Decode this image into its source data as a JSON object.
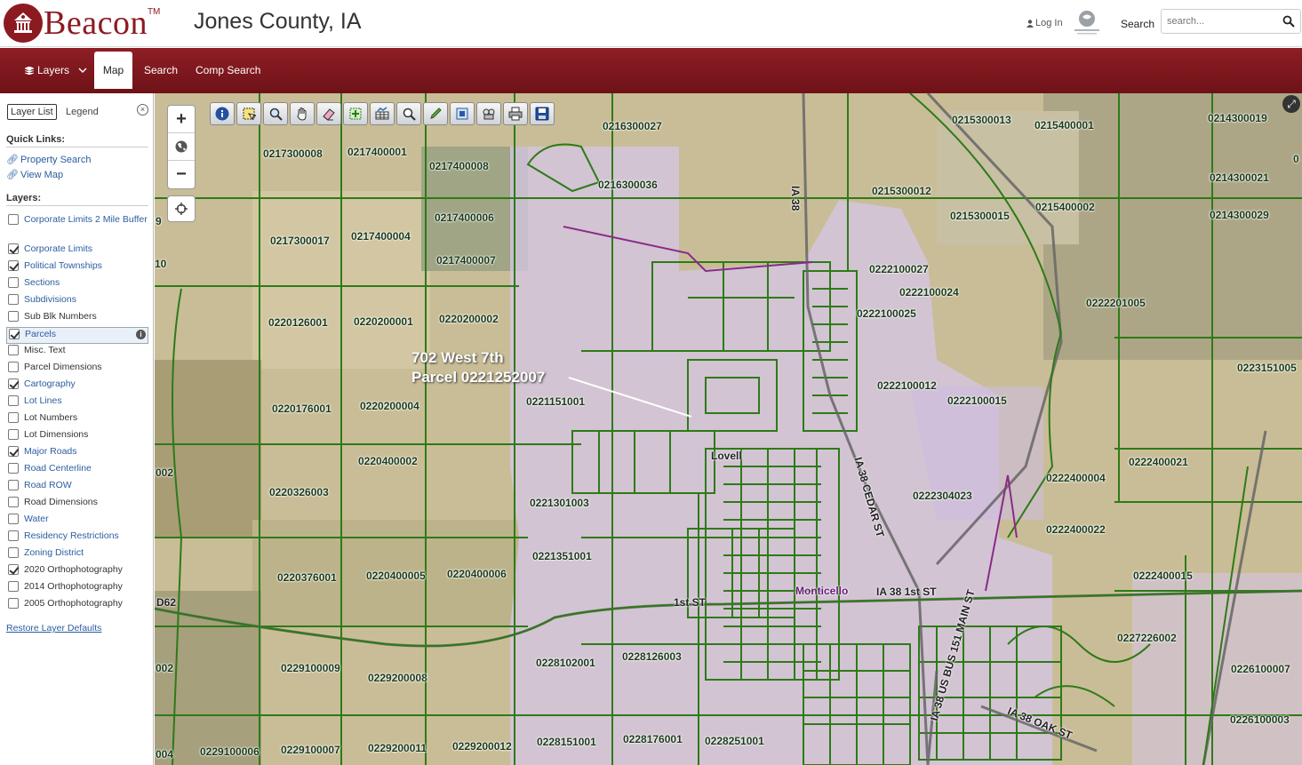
{
  "header": {
    "brand": "Beacon",
    "trademark": "TM",
    "county_title": "Jones County, IA",
    "login_label": "Log In",
    "search_label": "Search",
    "search_placeholder": "search..."
  },
  "nav": {
    "layers": "Layers",
    "map": "Map",
    "search": "Search",
    "comp_search": "Comp Search"
  },
  "panel": {
    "tab_layer_list": "Layer List",
    "tab_legend": "Legend",
    "quick_links_title": "Quick Links:",
    "quick_links": [
      "Property Search",
      "View Map"
    ],
    "layers_title": "Layers:",
    "layers": [
      {
        "label": "Corporate Limits 2 Mile Buffer",
        "checked": false
      },
      {
        "label": "Corporate Limits",
        "checked": true
      },
      {
        "label": "Political Townships",
        "checked": true
      },
      {
        "label": "Sections",
        "checked": false
      },
      {
        "label": "Subdivisions",
        "checked": false
      },
      {
        "label": "Sub Blk Numbers",
        "checked": false
      },
      {
        "label": "Parcels",
        "checked": true
      },
      {
        "label": "Misc. Text",
        "checked": false
      },
      {
        "label": "Parcel Dimensions",
        "checked": false
      },
      {
        "label": "Cartography",
        "checked": true
      },
      {
        "label": "Lot Lines",
        "checked": false
      },
      {
        "label": "Lot Numbers",
        "checked": false
      },
      {
        "label": "Lot Dimensions",
        "checked": false
      },
      {
        "label": "Major Roads",
        "checked": true
      },
      {
        "label": "Road Centerline",
        "checked": false
      },
      {
        "label": "Road ROW",
        "checked": false
      },
      {
        "label": "Road Dimensions",
        "checked": false
      },
      {
        "label": "Water",
        "checked": false
      },
      {
        "label": "Residency Restrictions",
        "checked": false
      },
      {
        "label": "Zoning District",
        "checked": false
      },
      {
        "label": "2020 Orthophotography",
        "checked": true
      },
      {
        "label": "2014 Orthophotography",
        "checked": false
      },
      {
        "label": "2005 Orthophotography",
        "checked": false
      }
    ],
    "restore_label": "Restore Layer Defaults"
  },
  "map": {
    "callout_line1": "702 West 7th",
    "callout_line2": "Parcel 0221252007",
    "town_label": "Lovell",
    "city_label": "Monticello",
    "parcels": [
      "0216300027",
      "0215300013",
      "0215400001",
      "0214300019",
      "0217300008",
      "0217400001",
      "0217400008",
      "0216300036",
      "0215300012",
      "0214300021",
      "0217400006",
      "0215300015",
      "0215400002",
      "0214300029",
      "0217300017",
      "0217400004",
      "0217400007",
      "0222100027",
      "0222100024",
      "0220126001",
      "0220200001",
      "0220200002",
      "0222100025",
      "0222201005",
      "0223151005",
      "0221151001",
      "0222100012",
      "0222100015",
      "0220176001",
      "0220200004",
      "0222400021",
      "0220400002",
      "0222304023",
      "0222400004",
      "0220326003",
      "0221301003",
      "0222400022",
      "0221351001",
      "0220376001",
      "0220400005",
      "0220400006",
      "0222400015",
      "0227226002",
      "0228102001",
      "0228126003",
      "0226100007",
      "0229100009",
      "0229200008",
      "0228151001",
      "0228176001",
      "0228251001",
      "0226100003",
      "0229100006",
      "0229100007",
      "0229200011",
      "0229200012"
    ],
    "edge_labels": [
      "9",
      "10",
      "002",
      "002",
      "004",
      "0"
    ],
    "roads": [
      "IA 38",
      "IA 38 CEDAR ST",
      "1st ST",
      "IA 38 1st ST",
      "IA 38 US BUS 151 MAIN ST",
      "IA 38 OAK ST",
      "D62"
    ]
  },
  "icons": {
    "login": "user-icon",
    "search": "magnifier-icon",
    "layers": "layers-stack-icon",
    "link": "link-icon"
  },
  "colors": {
    "brand": "#8c1b21",
    "nav_bg": "#7d171d",
    "parcel_line": "#2e7d1a",
    "corporate_overlay": "#d7c7e6"
  }
}
